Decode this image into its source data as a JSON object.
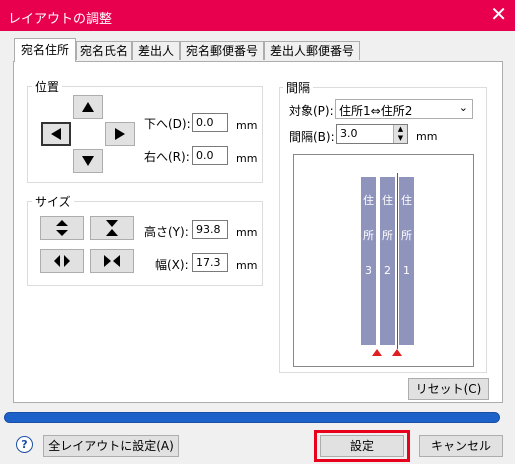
{
  "window": {
    "title": "レイアウトの調整",
    "close": "✕"
  },
  "tabs": [
    "宛名住所",
    "宛名氏名",
    "差出人",
    "宛名郵便番号",
    "差出人郵便番号"
  ],
  "position": {
    "label": "位置",
    "down_label": "下へ(D):",
    "down_value": "0.0",
    "right_label": "右へ(R):",
    "right_value": "0.0",
    "unit": "mm"
  },
  "size": {
    "label": "サイズ",
    "height_label": "高さ(Y):",
    "height_value": "93.8",
    "width_label": "幅(X):",
    "width_value": "17.3",
    "unit": "mm"
  },
  "spacing": {
    "label": "間隔",
    "target_label": "対象(P):",
    "target_value": "住所1⇔住所2",
    "interval_label": "間隔(B):",
    "interval_value": "3.0",
    "unit": "mm"
  },
  "preview": {
    "columns": [
      {
        "chars": [
          "住",
          "所",
          "3"
        ]
      },
      {
        "chars": [
          "住",
          "所",
          "2"
        ]
      },
      {
        "chars": [
          "住",
          "所",
          "1"
        ]
      }
    ]
  },
  "reset_button": "リセット(C)",
  "progress": 1.0,
  "footer": {
    "help": "?",
    "apply_all": "全レイアウトに設定(A)",
    "ok": "設定",
    "cancel": "キャンセル"
  },
  "colors": {
    "titlebar": "#e8004f",
    "preview_column": "#8f94bd",
    "marker": "#e02020",
    "highlight": "#e8001c"
  }
}
